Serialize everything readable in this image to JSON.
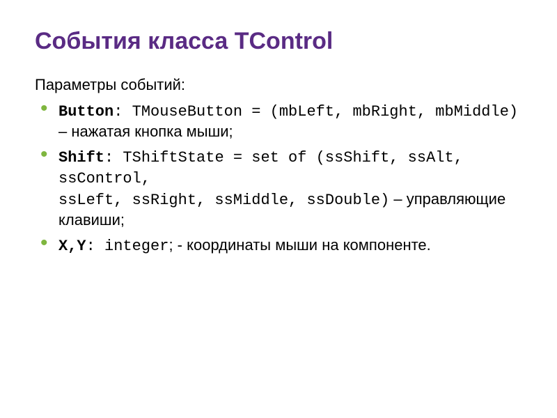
{
  "title": "События класса TControl",
  "subtitle": "Параметры событий:",
  "items": [
    {
      "label": "Button",
      "code": ": TMouseButton = (mbLeft, mbRight, mbMiddle)",
      "desc": " – нажатая кнопка мыши;"
    },
    {
      "label": "Shift",
      "code1": ": TShiftState = set of (ssShift, ssAlt, ssControl,",
      "code2": "               ssLeft, ssRight, ssMiddle, ssDouble)",
      "desc": " – управляющие клавиши;"
    },
    {
      "label": "X,Y",
      "code": ": integer",
      "desc": "; - координаты мыши на компоненте."
    }
  ]
}
